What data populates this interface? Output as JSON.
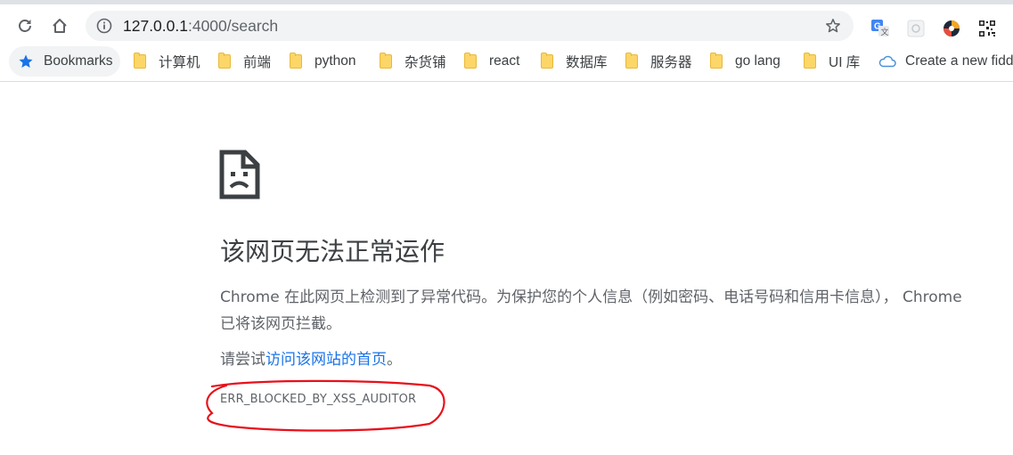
{
  "omnibox": {
    "url_host": "127.0.0.1",
    "url_path": ":4000/search"
  },
  "bookmarks_bar": {
    "items": [
      {
        "label": "Bookmarks",
        "icon": "star-icon"
      },
      {
        "label": "计算机",
        "icon": "folder-icon"
      },
      {
        "label": "前端",
        "icon": "folder-icon"
      },
      {
        "label": "python",
        "icon": "folder-icon"
      },
      {
        "label": "杂货铺",
        "icon": "folder-icon"
      },
      {
        "label": "react",
        "icon": "folder-icon"
      },
      {
        "label": "数据库",
        "icon": "folder-icon"
      },
      {
        "label": "服务器",
        "icon": "folder-icon"
      },
      {
        "label": "go lang",
        "icon": "folder-icon"
      },
      {
        "label": "UI 库",
        "icon": "folder-icon"
      },
      {
        "label": "Create a new fidd",
        "icon": "cloud-icon"
      }
    ]
  },
  "error_page": {
    "heading": "该网页无法正常运作",
    "description": "Chrome 在此网页上检测到了异常代码。为保护您的个人信息（例如密码、电话号码和信用卡信息）， Chrome\n已将该网页拦截。",
    "suggestion_prefix": "请尝试",
    "suggestion_link": "访问该网站的首页",
    "suggestion_suffix": "。",
    "error_code": "ERR_BLOCKED_BY_XSS_AUDITOR"
  },
  "colors": {
    "link": "#1a73e8",
    "annotation_circle": "#e8101a",
    "folder": "#fcd667"
  }
}
